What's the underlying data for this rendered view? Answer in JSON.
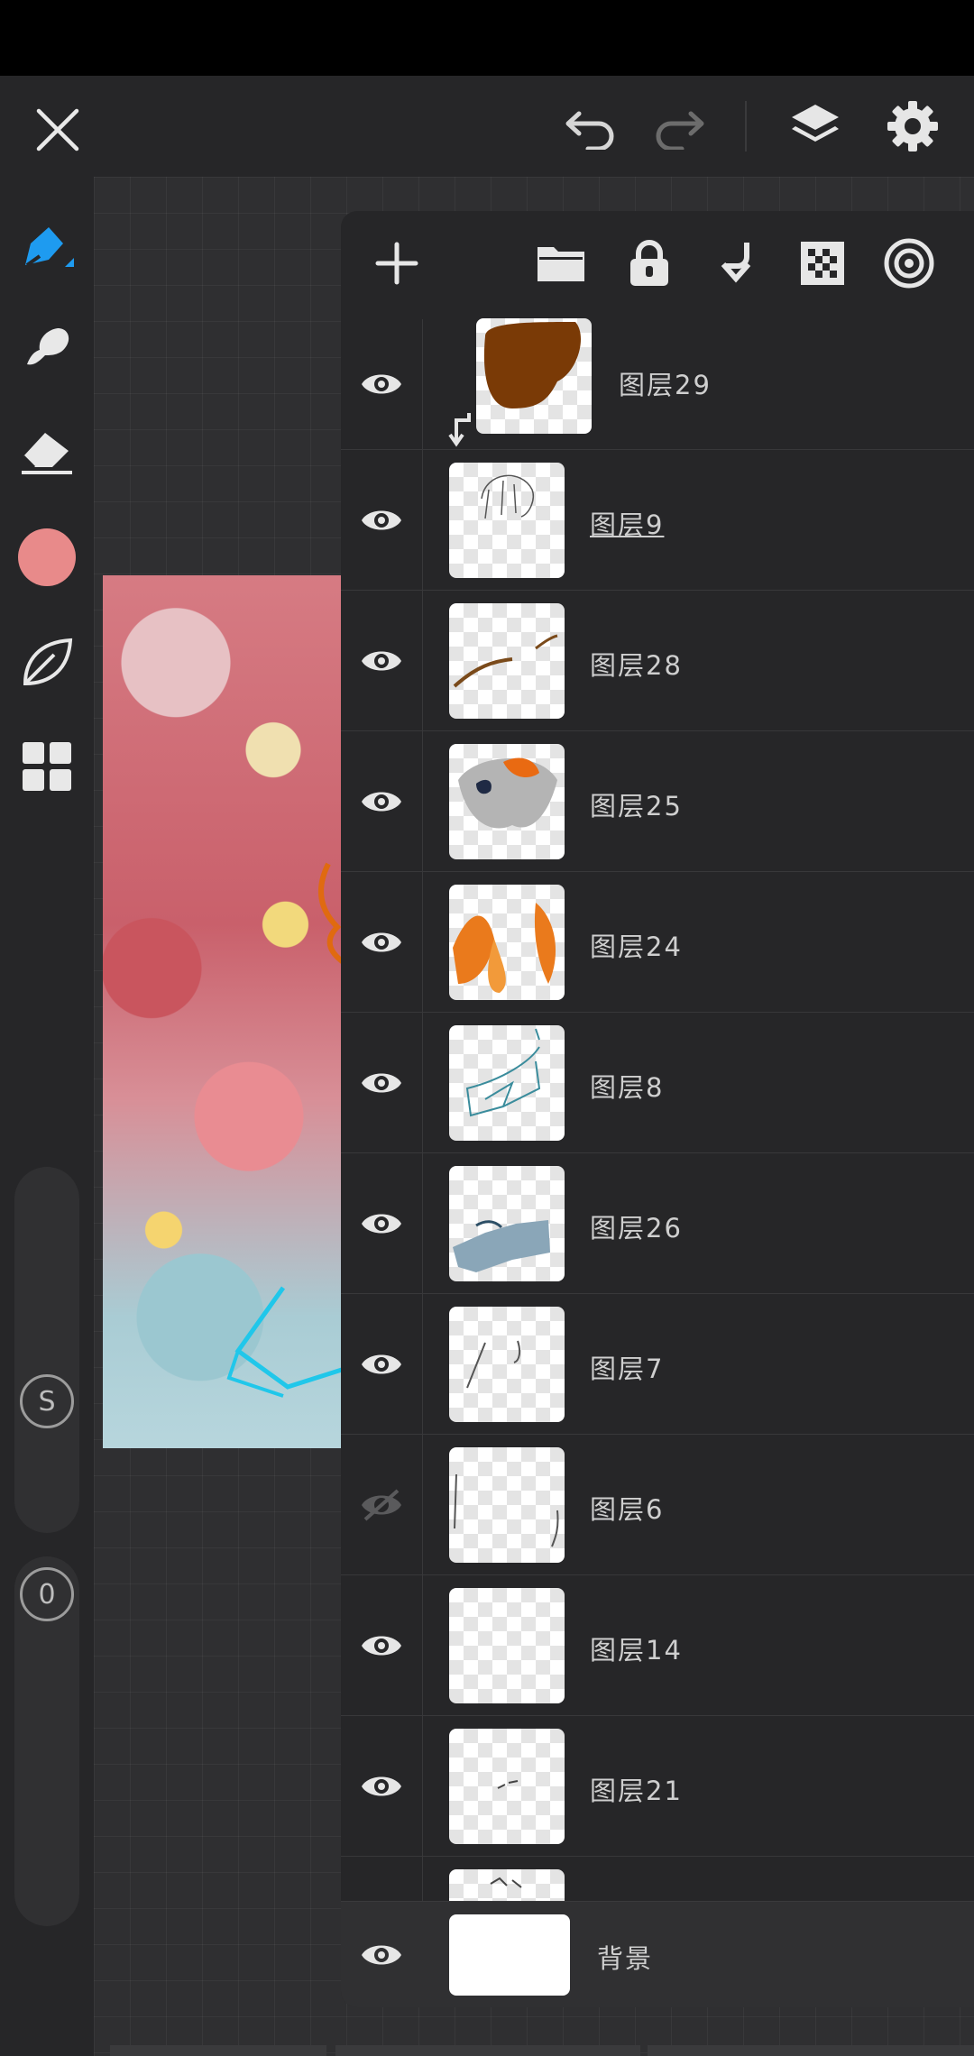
{
  "app": {
    "colors": {
      "accent": "#1e9bf0",
      "brush_color": "#e88a8a",
      "panel_bg": "#262628",
      "layer29_fill": "#7a3a06"
    }
  },
  "top_bar": {
    "icons": [
      "close-icon",
      "undo-icon",
      "redo-icon",
      "layers-icon",
      "settings-icon"
    ]
  },
  "left_toolbar": {
    "tools": [
      "brush-icon",
      "smudge-icon",
      "eraser-icon",
      "color-swatch",
      "leaf-icon",
      "grid-icon"
    ],
    "size_badge": "S",
    "opacity_badge": "0"
  },
  "layers_panel": {
    "toolbar_icons": [
      "add-layer-icon",
      "folder-icon",
      "lock-icon",
      "clip-mask-icon",
      "checker-icon",
      "blend-icon"
    ],
    "layers": [
      {
        "name": "图层29",
        "visible": true,
        "clipped": true,
        "selected": false
      },
      {
        "name": "图层9",
        "visible": true,
        "clipped": false,
        "selected": true
      },
      {
        "name": "图层28",
        "visible": true,
        "clipped": false,
        "selected": false
      },
      {
        "name": "图层25",
        "visible": true,
        "clipped": false,
        "selected": false
      },
      {
        "name": "图层24",
        "visible": true,
        "clipped": false,
        "selected": false
      },
      {
        "name": "图层8",
        "visible": true,
        "clipped": false,
        "selected": false
      },
      {
        "name": "图层26",
        "visible": true,
        "clipped": false,
        "selected": false
      },
      {
        "name": "图层7",
        "visible": true,
        "clipped": false,
        "selected": false
      },
      {
        "name": "图层6",
        "visible": false,
        "clipped": false,
        "selected": false
      },
      {
        "name": "图层14",
        "visible": true,
        "clipped": false,
        "selected": false
      },
      {
        "name": "图层21",
        "visible": true,
        "clipped": false,
        "selected": false
      }
    ],
    "background_layer": {
      "name": "背景",
      "visible": true
    }
  }
}
